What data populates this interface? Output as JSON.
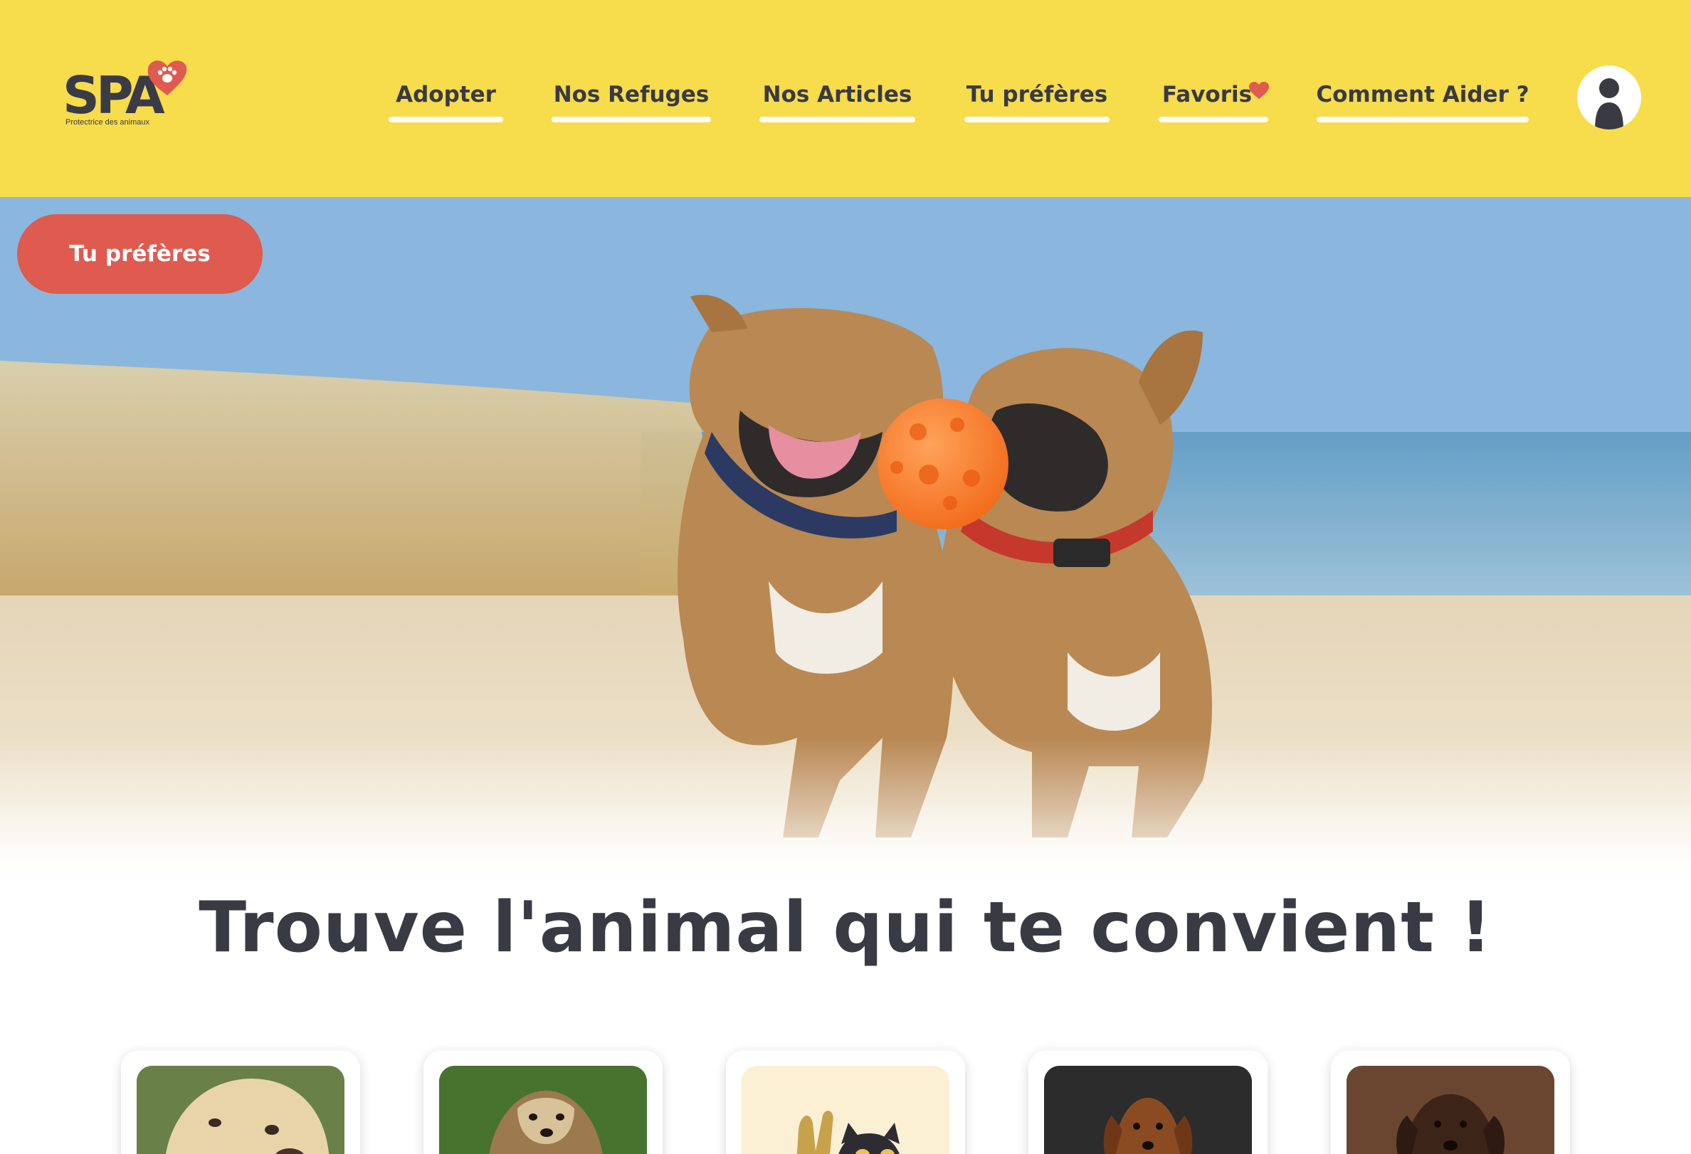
{
  "brand": {
    "logo_text": "SPA",
    "tagline": "Protectrice des animaux",
    "accent_color": "#df5a4f",
    "header_color": "#f7dc4b",
    "text_color": "#393a43"
  },
  "nav": {
    "items": [
      {
        "label": "Adopter"
      },
      {
        "label": "Nos Refuges"
      },
      {
        "label": "Nos Articles"
      },
      {
        "label": "Tu préfères"
      },
      {
        "label": "Favoris"
      },
      {
        "label": "Comment Aider ?"
      }
    ],
    "favorites_icon": "heart-icon",
    "account_icon": "user-avatar-icon"
  },
  "hero": {
    "cta_label": "Tu préfères",
    "headline": "Trouve l'animal qui te convient !"
  },
  "cards": [
    {
      "subject": "labrador-senior"
    },
    {
      "subject": "havanese-forest"
    },
    {
      "subject": "rabbit-and-cat-illustration"
    },
    {
      "subject": "dachshund"
    },
    {
      "subject": "chocolate-labrador"
    }
  ]
}
